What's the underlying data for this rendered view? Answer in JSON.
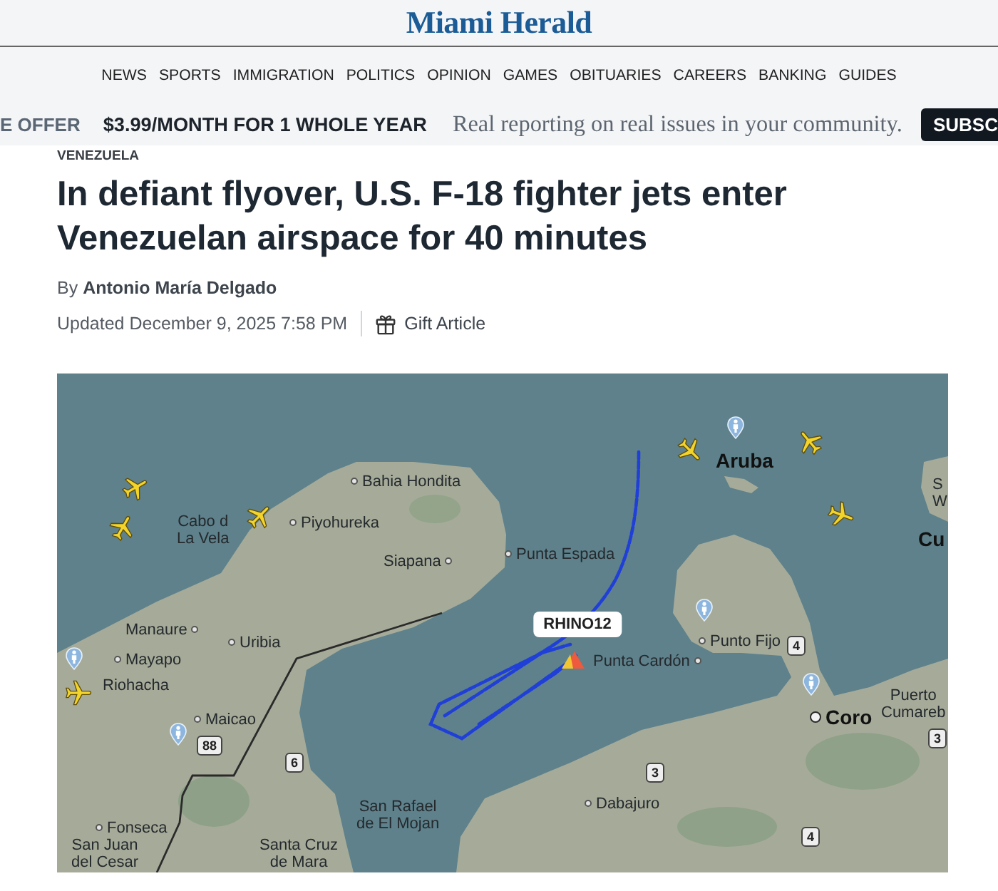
{
  "header": {
    "logo": "Miami Herald"
  },
  "nav": {
    "items": [
      "NEWS",
      "SPORTS",
      "IMMIGRATION",
      "POLITICS",
      "OPINION",
      "GAMES",
      "OBITUARIES",
      "CAREERS",
      "BANKING",
      "GUIDES"
    ]
  },
  "promo_bar": {
    "offer": "E OFFER",
    "price": "$3.99/MONTH FOR 1 WHOLE YEAR",
    "tagline": "Real reporting on real issues in your community.",
    "button": "SUBSC"
  },
  "article": {
    "section": "VENEZUELA",
    "headline": "In defiant flyover, U.S. F-18 fighter jets enter Venezuelan airspace for 40 minutes",
    "byline": "By **Antonio María Delgado**",
    "updated": "Updated December 9, 2025 7:58 PM",
    "gift_button": "Gift Article",
    "map": {
      "callout": "RHINO12",
      "labels": [
        {
          "text": "Aruba",
          "kind": "island"
        },
        {
          "text": "Bahia Hondita",
          "kind": "town"
        },
        {
          "text": "S",
          "kind": "label"
        },
        {
          "text": "W",
          "kind": "label"
        },
        {
          "text": "Piyohureka",
          "kind": "town"
        },
        {
          "text": "Cabo d\nLa Vela",
          "kind": "label"
        },
        {
          "text": "Cu",
          "kind": "island"
        },
        {
          "text": "Siapana",
          "kind": "town"
        },
        {
          "text": "Punta Espada",
          "kind": "town"
        },
        {
          "text": "Manaure",
          "kind": "town"
        },
        {
          "text": "Uribia",
          "kind": "town"
        },
        {
          "text": "Punto Fijo",
          "kind": "town"
        },
        {
          "text": "4",
          "kind": "route"
        },
        {
          "text": "Mayapo",
          "kind": "town"
        },
        {
          "text": "Punta Cardón",
          "kind": "town"
        },
        {
          "text": "Riohacha",
          "kind": "label"
        },
        {
          "text": "Puerto\nCumareb",
          "kind": "label"
        },
        {
          "text": "Maicao",
          "kind": "town"
        },
        {
          "text": "Coro",
          "kind": "city"
        },
        {
          "text": "3",
          "kind": "route"
        },
        {
          "text": "88",
          "kind": "route"
        },
        {
          "text": "6",
          "kind": "route"
        },
        {
          "text": "3",
          "kind": "route"
        },
        {
          "text": "San Rafael\nde El Mojan",
          "kind": "label"
        },
        {
          "text": "Dabajuro",
          "kind": "town"
        },
        {
          "text": "Fonseca",
          "kind": "town"
        },
        {
          "text": "4",
          "kind": "route"
        },
        {
          "text": "San Juan\ndel Cesar",
          "kind": "label"
        },
        {
          "text": "Santa Cruz\nde Mara",
          "kind": "label"
        }
      ]
    }
  }
}
